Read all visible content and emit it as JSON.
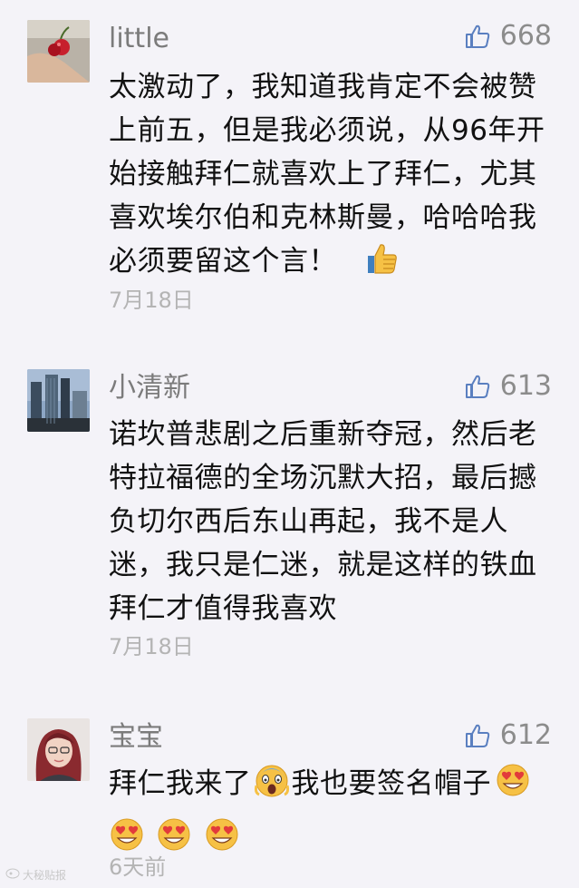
{
  "comments": [
    {
      "username": "little",
      "likes": "668",
      "lines": [
        "太激动了，我知道我肯定不会被赞",
        "上前五，但是我必须说，从96年开",
        "始接触拜仁就喜欢上了拜仁，尤其",
        "喜欢埃尔伯和克林斯曼，哈哈哈我",
        "必须要留这个言！"
      ],
      "date": "7月18日"
    },
    {
      "username": "小清新",
      "likes": "613",
      "lines": [
        "诺坎普悲剧之后重新夺冠，然后老",
        "特拉福德的全场沉默大招，最后撼",
        "负切尔西后东山再起，我不是人",
        "迷，我只是仁迷，就是这样的铁血",
        "拜仁才值得我喜欢"
      ],
      "date": "7月18日"
    },
    {
      "username": "宝宝",
      "likes": "612",
      "line1_a": "拜仁我来了",
      "line1_b": "我也要签名帽子",
      "date": "6天前"
    }
  ],
  "watermark": "大秘贴报"
}
